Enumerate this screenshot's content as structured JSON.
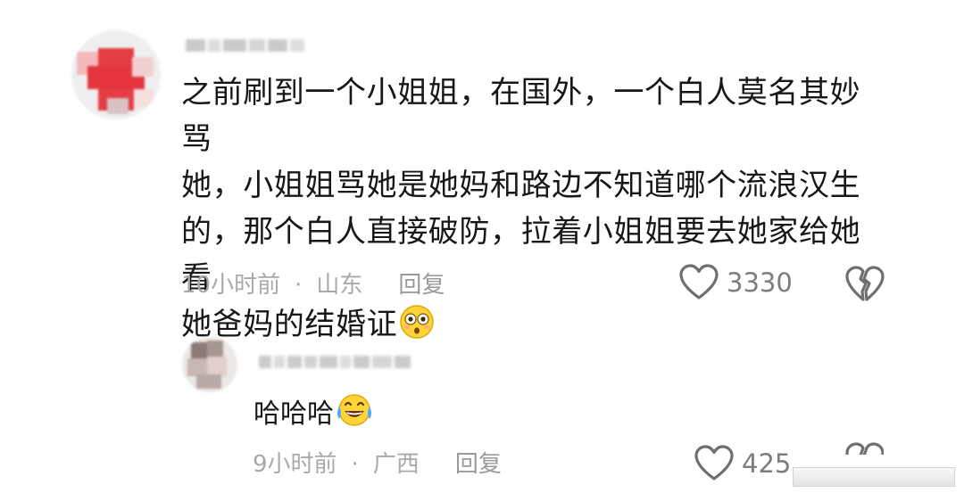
{
  "comment": {
    "text_lines": [
      "之前刷到一个小姐姐，在国外，一个白人莫名其妙骂",
      "她，小姐姐骂她是她妈和路边不知道哪个流浪汉生",
      "的，那个白人直接破防，拉着小姐姐要去她家给她看",
      "她爸妈的结婚证"
    ],
    "emoji": "flushed-face-emoji",
    "time": "10小时前",
    "separator": "·",
    "location": "山东",
    "reply_label": "回复",
    "like_count": "3330",
    "like_icon": "heart-outline-icon",
    "dislike_icon": "broken-heart-icon"
  },
  "reply": {
    "text": "哈哈哈",
    "emoji": "tears-of-joy-emoji",
    "time": "9小时前",
    "separator": "·",
    "location": "广西",
    "reply_label": "回复",
    "like_count": "425",
    "like_icon": "heart-outline-icon",
    "dislike_icon": "broken-heart-icon"
  },
  "colors": {
    "text": "#171717",
    "meta": "#a9a9a9",
    "icon": "#6f6f6f",
    "avatar_accent": "#e8424a"
  }
}
